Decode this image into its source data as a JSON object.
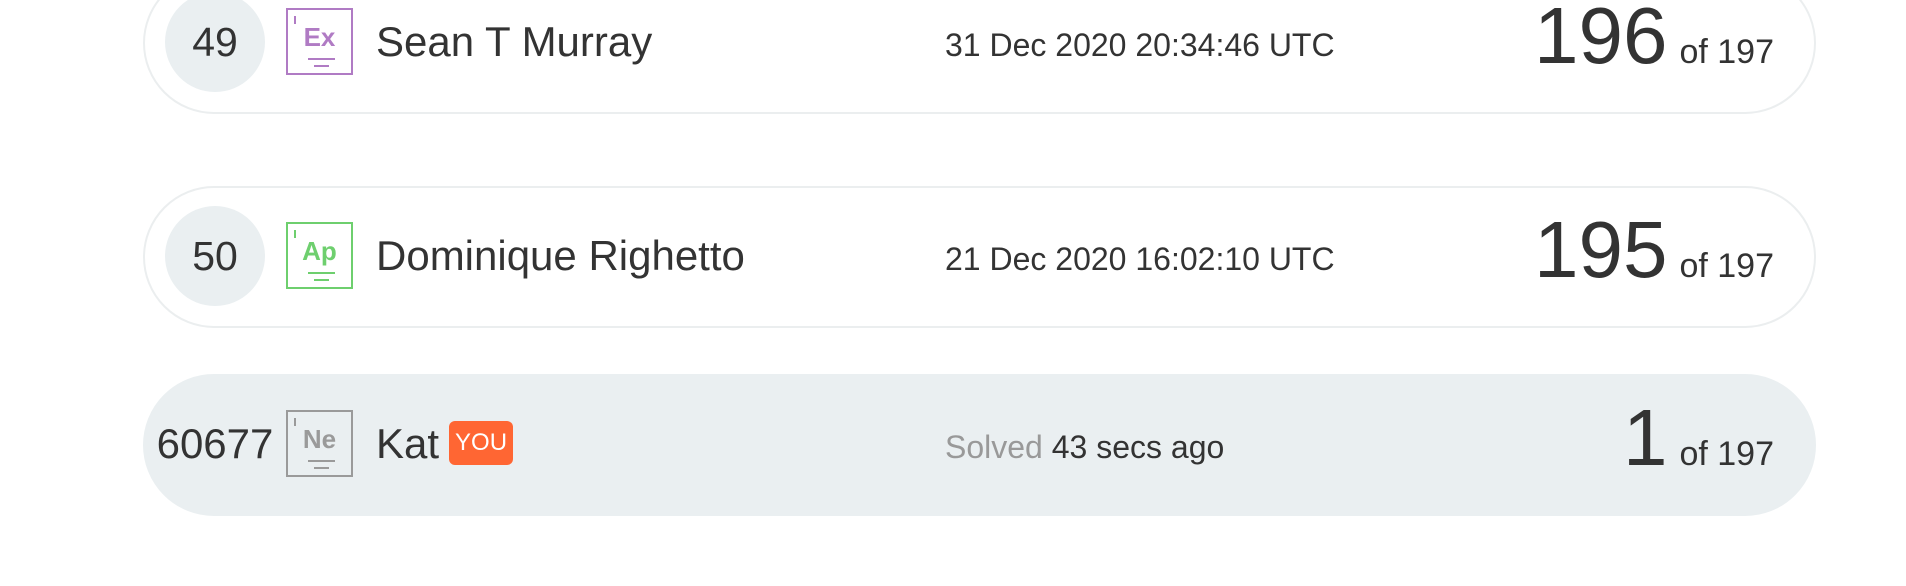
{
  "leaderboard": {
    "rows": [
      {
        "rank": "49",
        "badge": {
          "symbol": "Ex",
          "color": "#b07bc4"
        },
        "name": "Sean T Murray",
        "date": "31 Dec 2020 20:34:46 UTC",
        "score": "196",
        "total": "of 197"
      },
      {
        "rank": "50",
        "badge": {
          "symbol": "Ap",
          "color": "#6ecf6e"
        },
        "name": "Dominique Righetto",
        "date": "21 Dec 2020 16:02:10 UTC",
        "score": "195",
        "total": "of 197"
      },
      {
        "rank": "60677",
        "badge": {
          "symbol": "Ne",
          "color": "#9a9a9a"
        },
        "name": "Kat",
        "you_tag": "YOU",
        "solved_prefix": "Solved",
        "date": "43 secs ago",
        "score": "1",
        "total": "of 197"
      }
    ]
  },
  "colors": {
    "row_border": "#ebeeef",
    "highlight_row": "#eaeff1",
    "you_tag": "#ff6633"
  }
}
